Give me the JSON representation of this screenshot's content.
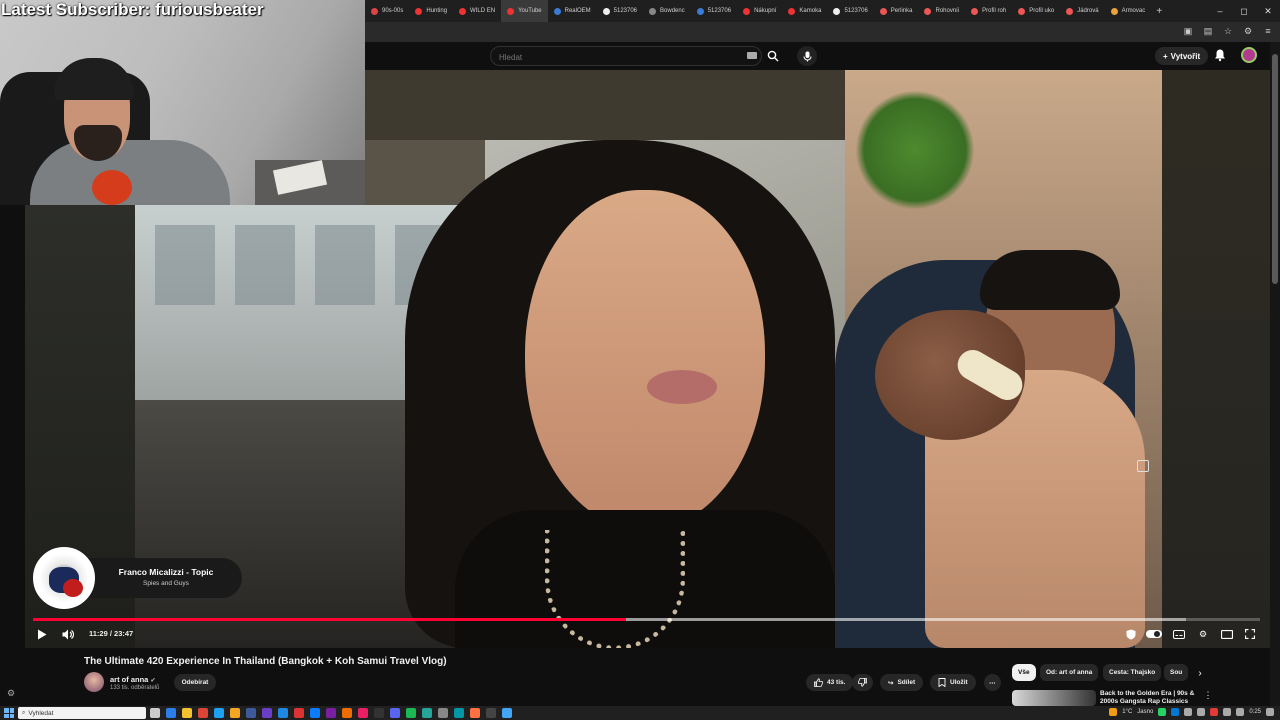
{
  "stream_overlay": {
    "subscriber_text": "Latest Subscriber: furiousbeater"
  },
  "browser": {
    "tabs": [
      {
        "label": "90s-00s",
        "color": "#d44"
      },
      {
        "label": "Hunting",
        "color": "#e33"
      },
      {
        "label": "WILD EN",
        "color": "#e33"
      },
      {
        "label": "YouTube",
        "color": "#e33"
      },
      {
        "label": "RealOEM",
        "color": "#3a7bd5"
      },
      {
        "label": "5123706",
        "color": "#eee"
      },
      {
        "label": "Bowdenc",
        "color": "#888"
      },
      {
        "label": "5123706",
        "color": "#3a7bd5"
      },
      {
        "label": "Nákupní",
        "color": "#e33"
      },
      {
        "label": "Kamoka",
        "color": "#e33"
      },
      {
        "label": "5123706",
        "color": "#eee"
      },
      {
        "label": "Perlinka",
        "color": "#e55"
      },
      {
        "label": "Rohovníi",
        "color": "#e55"
      },
      {
        "label": "Profil roh",
        "color": "#e55"
      },
      {
        "label": "Profil uko",
        "color": "#e55"
      },
      {
        "label": "Jádrová",
        "color": "#e55"
      },
      {
        "label": "Armovac",
        "color": "#e9a23b"
      }
    ],
    "new_tab_label": "+",
    "window_controls": [
      "–",
      "◻",
      "✕"
    ]
  },
  "youtube": {
    "search": {
      "placeholder": "Hledat"
    },
    "create_label": "Vytvořit",
    "video": {
      "title": "The Ultimate 420 Experience In Thailand (Bangkok + Koh Samui Travel Vlog)",
      "time_display": "11:29 / 23:47",
      "progress": 0.483,
      "buffered": 0.94
    },
    "now_playing": {
      "title": "Franco Micalizzi - Topic",
      "subtitle": "Spies and Guys"
    },
    "channel": {
      "name": "art of anna",
      "verified": "✔",
      "subscribers": "133 tis. odběratelů",
      "subscribe_label": "Odebírat"
    },
    "actions": {
      "likes": "43 tis.",
      "share": "Sdílet",
      "save": "Uložit",
      "more": "⋯"
    },
    "chips": [
      "Vše",
      "Od: art of anna",
      "Cesta: Thajsko",
      "Sou"
    ],
    "recommendation": {
      "title": "Back to the Golden Era | 90s & 2000s Gangsta Rap Classics"
    }
  },
  "taskbar": {
    "search_placeholder": "Vyhledat",
    "weather": "1°C",
    "weather_desc": "Jasno",
    "clock": "0:25"
  }
}
